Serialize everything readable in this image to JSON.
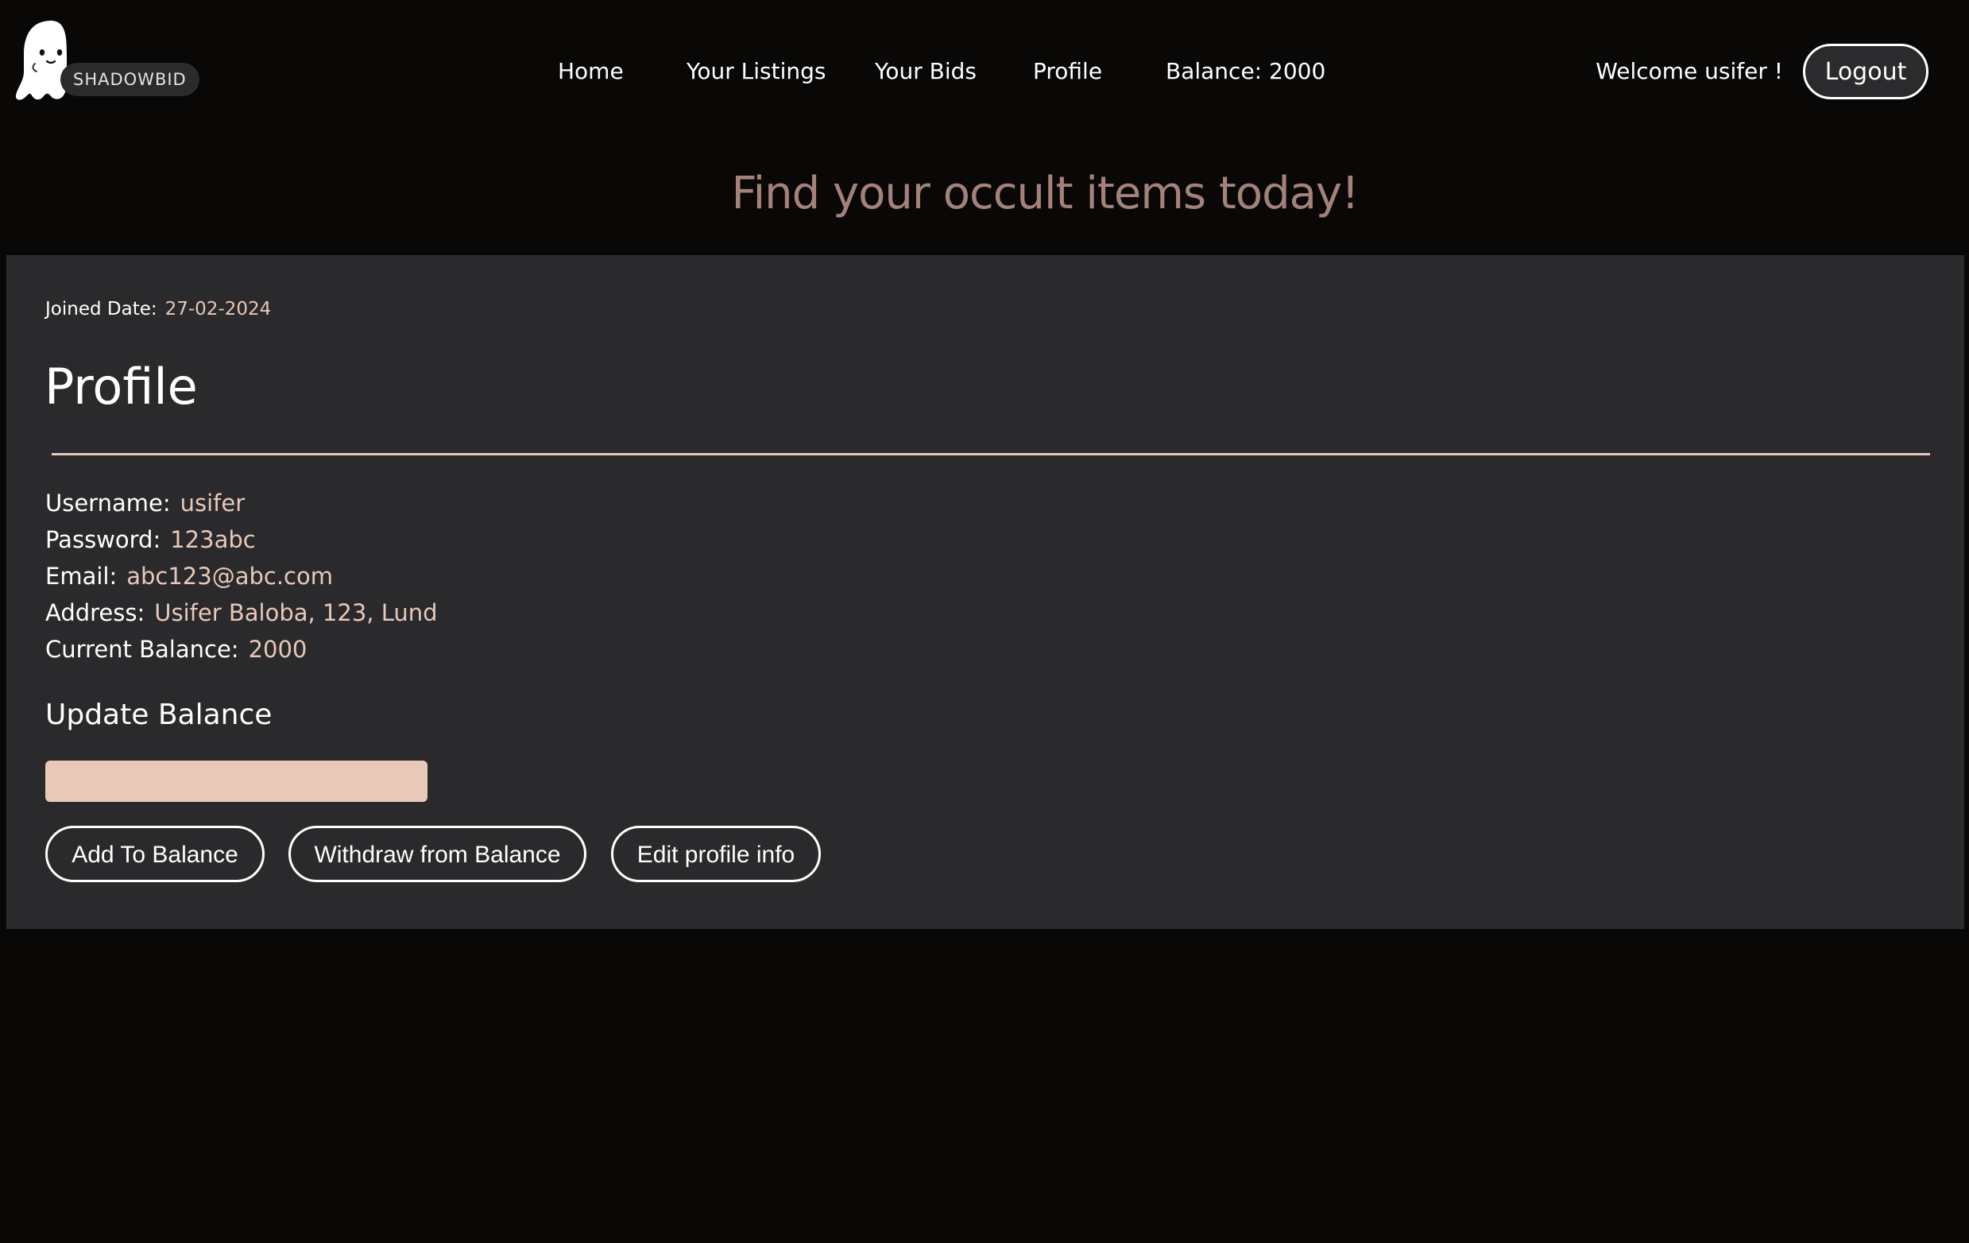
{
  "brand": {
    "name": "SHADOWBID",
    "logo_icon": "ghost-icon"
  },
  "nav": {
    "items": [
      {
        "label": "Home"
      },
      {
        "label": "Your Listings"
      },
      {
        "label": "Your Bids"
      },
      {
        "label": "Profile"
      },
      {
        "label": "Balance: 2000"
      }
    ]
  },
  "user": {
    "welcome": "Welcome usifer !",
    "logout_label": "Logout"
  },
  "tagline": "Find your occult items today!",
  "profile": {
    "joined_label": "Joined Date:",
    "joined_value": "27-02-2024",
    "title": "Profile",
    "fields": [
      {
        "label": "Username:",
        "value": "usifer"
      },
      {
        "label": "Password:",
        "value": "123abc"
      },
      {
        "label": "Email:",
        "value": "abc123@abc.com"
      },
      {
        "label": "Address:",
        "value": "Usifer Baloba, 123, Lund"
      },
      {
        "label": "Current Balance:",
        "value": "2000"
      }
    ],
    "update_title": "Update Balance",
    "balance_input": {
      "value": "",
      "placeholder": ""
    },
    "buttons": {
      "add": "Add To Balance",
      "withdraw": "Withdraw from Balance",
      "edit": "Edit profile info"
    }
  },
  "colors": {
    "background": "#090807",
    "panel": "#2a292c",
    "accent": "#e8c9b8",
    "tagline": "#a4827a"
  }
}
